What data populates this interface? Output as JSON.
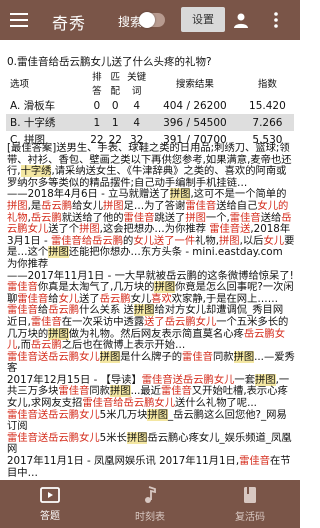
{
  "header": {
    "title": "奇秀",
    "search_label": "搜索",
    "settings_label": "设置"
  },
  "query": "0.雷佳音给岳云鹏女儿送了什么头疼的礼物?",
  "table": {
    "headers": [
      "选项",
      "排答",
      "匹配",
      "关键词",
      "搜索结果",
      "指数"
    ],
    "rows": [
      [
        "A. 滑板车",
        "0",
        "0",
        "4",
        "404 / 26200",
        "15.420"
      ],
      [
        "B. 十字绣",
        "1",
        "1",
        "4",
        "396 / 54500",
        "7.266"
      ],
      [
        "C. 拼图",
        "22",
        "22",
        "32",
        "391 / 70700",
        "5.530"
      ]
    ]
  },
  "results": [
    [
      [
        "",
        "[最佳答案]送男生、手表、球鞋之类的日用品;刺绣刀、篮球;领带、衬衫、香包、壁画之类以下再供您参考,如果满意,麦帝也还行,"
      ],
      [
        "hl",
        "十字绣"
      ],
      [
        "",
        ",请采纳送女生、《牛津辞典》之类的、喜欢的阿南或罗纳尔多等类似的精品摆件;自己动手编制手机挂链…"
      ]
    ],
    [
      [
        "",
        "——2018年4月6日 - 立马就赠送了"
      ],
      [
        "hl",
        "拼图"
      ],
      [
        "",
        ",这可不是一个简单的"
      ],
      [
        "red",
        "拼图"
      ],
      [
        "",
        ",是"
      ],
      [
        "red",
        "岳云鹏"
      ],
      [
        "",
        "给女儿"
      ],
      [
        "red",
        "拼图"
      ],
      [
        "",
        "足…为了答谢"
      ],
      [
        "red",
        "雷佳音"
      ],
      [
        "",
        "送给自己"
      ],
      [
        "red",
        "女儿的礼物"
      ],
      [
        "",
        ","
      ],
      [
        "red",
        "岳云鹏"
      ],
      [
        "",
        "就送给了他的"
      ],
      [
        "red",
        "雷佳音"
      ],
      [
        "",
        "跳送了"
      ],
      [
        "red",
        "拼图"
      ],
      [
        "",
        "一个,"
      ],
      [
        "red",
        "雷佳音"
      ],
      [
        "",
        "送给"
      ],
      [
        "red",
        "岳云鹏女儿"
      ],
      [
        "",
        "送了个"
      ],
      [
        "red",
        "拼图"
      ],
      [
        "",
        ",这会把想办…为你推荐 "
      ],
      [
        "red",
        "雷佳音送"
      ],
      [
        "",
        ",2018年3月1日 - "
      ],
      [
        "red",
        "雷佳音给岳云鹏"
      ],
      [
        "",
        "的"
      ],
      [
        "red",
        "女儿送了一件"
      ],
      [
        "",
        "礼物,"
      ],
      [
        "red",
        "拼图"
      ],
      [
        "",
        ",以后"
      ],
      [
        "red",
        "女儿"
      ],
      [
        "",
        "要是…这个"
      ],
      [
        "hl",
        "拼图"
      ],
      [
        "",
        "还能把你想办…东方头条 - mini.eastday.com 为你推荐"
      ]
    ],
    [
      [
        "",
        "——2017年11月1日 - 一大早就被岳云鹏的这条微博给惊呆了!"
      ],
      [
        "red",
        "雷佳音"
      ],
      [
        "",
        "你真是太淘气了,几万块的"
      ],
      [
        "hl",
        "拼图"
      ],
      [
        "",
        "你竟是怎么回事呢?一次闲聊"
      ],
      [
        "red",
        "雷佳音"
      ],
      [
        "",
        "给"
      ],
      [
        "red",
        "女儿"
      ],
      [
        "",
        "送了"
      ],
      [
        "red",
        "岳云鹏"
      ],
      [
        "",
        "女儿"
      ],
      [
        "red",
        "喜欢"
      ],
      [
        "",
        "欢家静,于是在网上……"
      ]
    ],
    [
      [
        "red",
        "雷佳音"
      ],
      [
        "",
        "给"
      ],
      [
        "red",
        "岳云鹏"
      ],
      [
        "",
        "什么关系 送"
      ],
      [
        "hl",
        "拼图"
      ],
      [
        "",
        "给对方女儿却遭调侃_秀目网 近日,"
      ],
      [
        "red",
        "雷佳音"
      ],
      [
        "",
        "在一次采访中透露"
      ],
      [
        "red",
        "送了岳云鹏女儿"
      ],
      [
        "",
        "一个五米多长的几万块的"
      ],
      [
        "hl",
        "拼图"
      ],
      [
        "",
        "做为礼物。然后网友表示简直莫名心疼"
      ],
      [
        "red",
        "岳云鹏女儿"
      ],
      [
        "",
        ",而"
      ],
      [
        "red",
        "岳云鹏"
      ],
      [
        "",
        "之后也在微博上表示开始…"
      ]
    ],
    [
      [
        "red",
        "雷佳音送岳云鹏女儿"
      ],
      [
        "hl",
        "拼图"
      ],
      [
        "",
        "是什么牌子的"
      ],
      [
        "red",
        "雷佳音"
      ],
      [
        "",
        "同款"
      ],
      [
        "hl",
        "拼图"
      ],
      [
        "",
        "...—爱秀客"
      ]
    ],
    [
      [
        "",
        "2017年12月15日 - 【导读】"
      ],
      [
        "red",
        "雷佳音送岳云鹏女儿"
      ],
      [
        "",
        "一套"
      ],
      [
        "hl",
        "拼图"
      ],
      [
        "",
        ",一共三万多块"
      ],
      [
        "red",
        "雷佳音"
      ],
      [
        "",
        "同款"
      ],
      [
        "hl",
        "拼图"
      ],
      [
        "",
        "...最近"
      ],
      [
        "red",
        "雷佳音"
      ],
      [
        "",
        "又开始吐槽,表示心疼女儿,求网友支招"
      ],
      [
        "red",
        "雷佳音给岳云鹏女儿"
      ],
      [
        "",
        "送什么礼物了呢..."
      ]
    ],
    [
      [
        "red",
        "雷佳音送岳云鹏女儿"
      ],
      [
        "",
        "5米几万块"
      ],
      [
        "hl",
        "拼图"
      ],
      [
        "",
        "_岳云鹏这么回您他?_网易订阅"
      ]
    ],
    [
      [
        "red",
        "雷佳音送岳云鹏女儿"
      ],
      [
        "",
        "5米长"
      ],
      [
        "hl",
        "拼图"
      ],
      [
        "",
        "岳云鹏心疼女儿_娱乐频道_凤凰网"
      ]
    ],
    [
      [
        "",
        "2017年11月1日 - 凤凰网娱乐讯 2017年11月1日,"
      ],
      [
        "red",
        "雷佳音"
      ],
      [
        "",
        "在节目中…"
      ]
    ]
  ],
  "nav": [
    {
      "label": "答题",
      "icon": "play-card-icon",
      "active": true
    },
    {
      "label": "时刻表",
      "icon": "music-note-icon",
      "active": false
    },
    {
      "label": "复活码",
      "icon": "book-icon",
      "active": false
    }
  ]
}
